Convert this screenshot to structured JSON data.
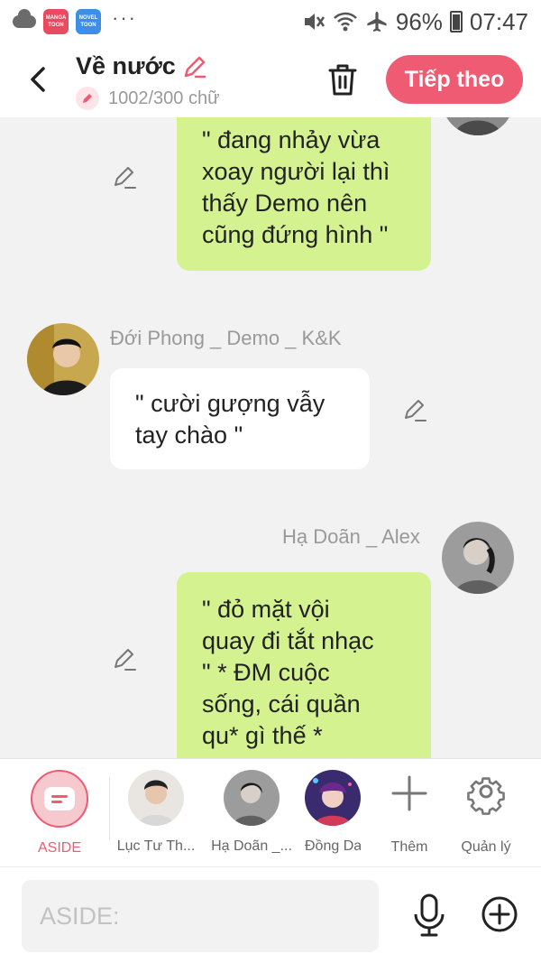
{
  "status_bar": {
    "apps": [
      {
        "name": "MANGA TOON",
        "color": "#e84a5f"
      },
      {
        "name": "NOVEL TOON",
        "color": "#3c8ee6"
      }
    ],
    "more": "···",
    "battery": "96%",
    "time": "07:47"
  },
  "header": {
    "title": "Về nước",
    "word_count": "1002/300 chữ",
    "next_label": "Tiếp theo"
  },
  "messages": [
    {
      "text_lines": [
        "\" đang nhảy vừa",
        "xoay người lại thì",
        "thấy Demo nên",
        "cũng đứng hình \""
      ]
    },
    {
      "sender": "Đới Phong _ Demo _ K&K",
      "text_lines": [
        "\" cười gượng vẫy",
        "tay chào \""
      ]
    },
    {
      "sender": "Hạ Doãn _ Alex",
      "text_lines": [
        "\" đỏ mặt vội",
        "quay đi tắt nhạc",
        "\" * ĐM cuộc",
        "sống, cái quần",
        "qu* gì thế *"
      ]
    }
  ],
  "characters": [
    {
      "label": "ASIDE"
    },
    {
      "label": "Lục Tư Th..."
    },
    {
      "label": "Hạ Doãn _..."
    },
    {
      "label": "Đồng Da"
    },
    {
      "label": "Thêm"
    },
    {
      "label": "Quản lý"
    }
  ],
  "input": {
    "placeholder": "ASIDE:"
  },
  "colors": {
    "accent": "#ef5b72",
    "green_bubble": "#d4f290"
  }
}
